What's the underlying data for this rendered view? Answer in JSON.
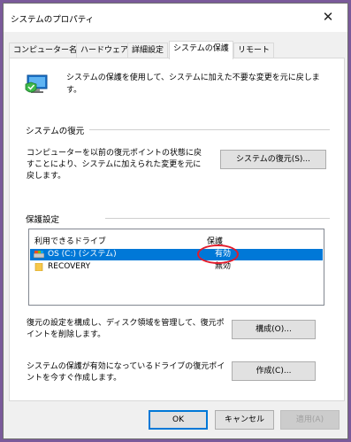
{
  "window": {
    "title": "システムのプロパティ",
    "close_glyph": "✕"
  },
  "tabs": [
    {
      "label": "コンピューター名",
      "active": false
    },
    {
      "label": "ハードウェア",
      "active": false
    },
    {
      "label": "詳細設定",
      "active": false
    },
    {
      "label": "システムの保護",
      "active": true
    },
    {
      "label": "リモート",
      "active": false
    }
  ],
  "intro": {
    "icon": "system-protection-shield-icon",
    "text": "システムの保護を使用して、システムに加えた不要な変更を元に戻します。"
  },
  "restore_section": {
    "heading": "システムの復元",
    "description": "コンピューターを以前の復元ポイントの状態に戻すことにより、システムに加えられた変更を元に戻します。",
    "button_label": "システムの復元(S)..."
  },
  "protection_section": {
    "heading": "保護設定",
    "columns": [
      "利用できるドライブ",
      "保護"
    ],
    "drives": [
      {
        "name": "OS (C:) (システム)",
        "status": "有効",
        "icon": "system-drive-icon",
        "selected": true
      },
      {
        "name": "RECOVERY",
        "status": "無効",
        "icon": "folder-drive-icon",
        "selected": false
      }
    ],
    "configure": {
      "description": "復元の設定を構成し、ディスク領域を管理して、復元ポイントを削除します。",
      "button_label": "構成(O)..."
    },
    "create": {
      "description": "システムの保護が有効になっているドライブの復元ポイントを今すぐ作成します。",
      "button_label": "作成(C)..."
    }
  },
  "footer": {
    "ok_label": "OK",
    "cancel_label": "キャンセル",
    "apply_label": "適用(A)"
  },
  "colors": {
    "selection": "#0078d7",
    "annotation": "#e21b2b",
    "background": "#7a5a9a"
  }
}
